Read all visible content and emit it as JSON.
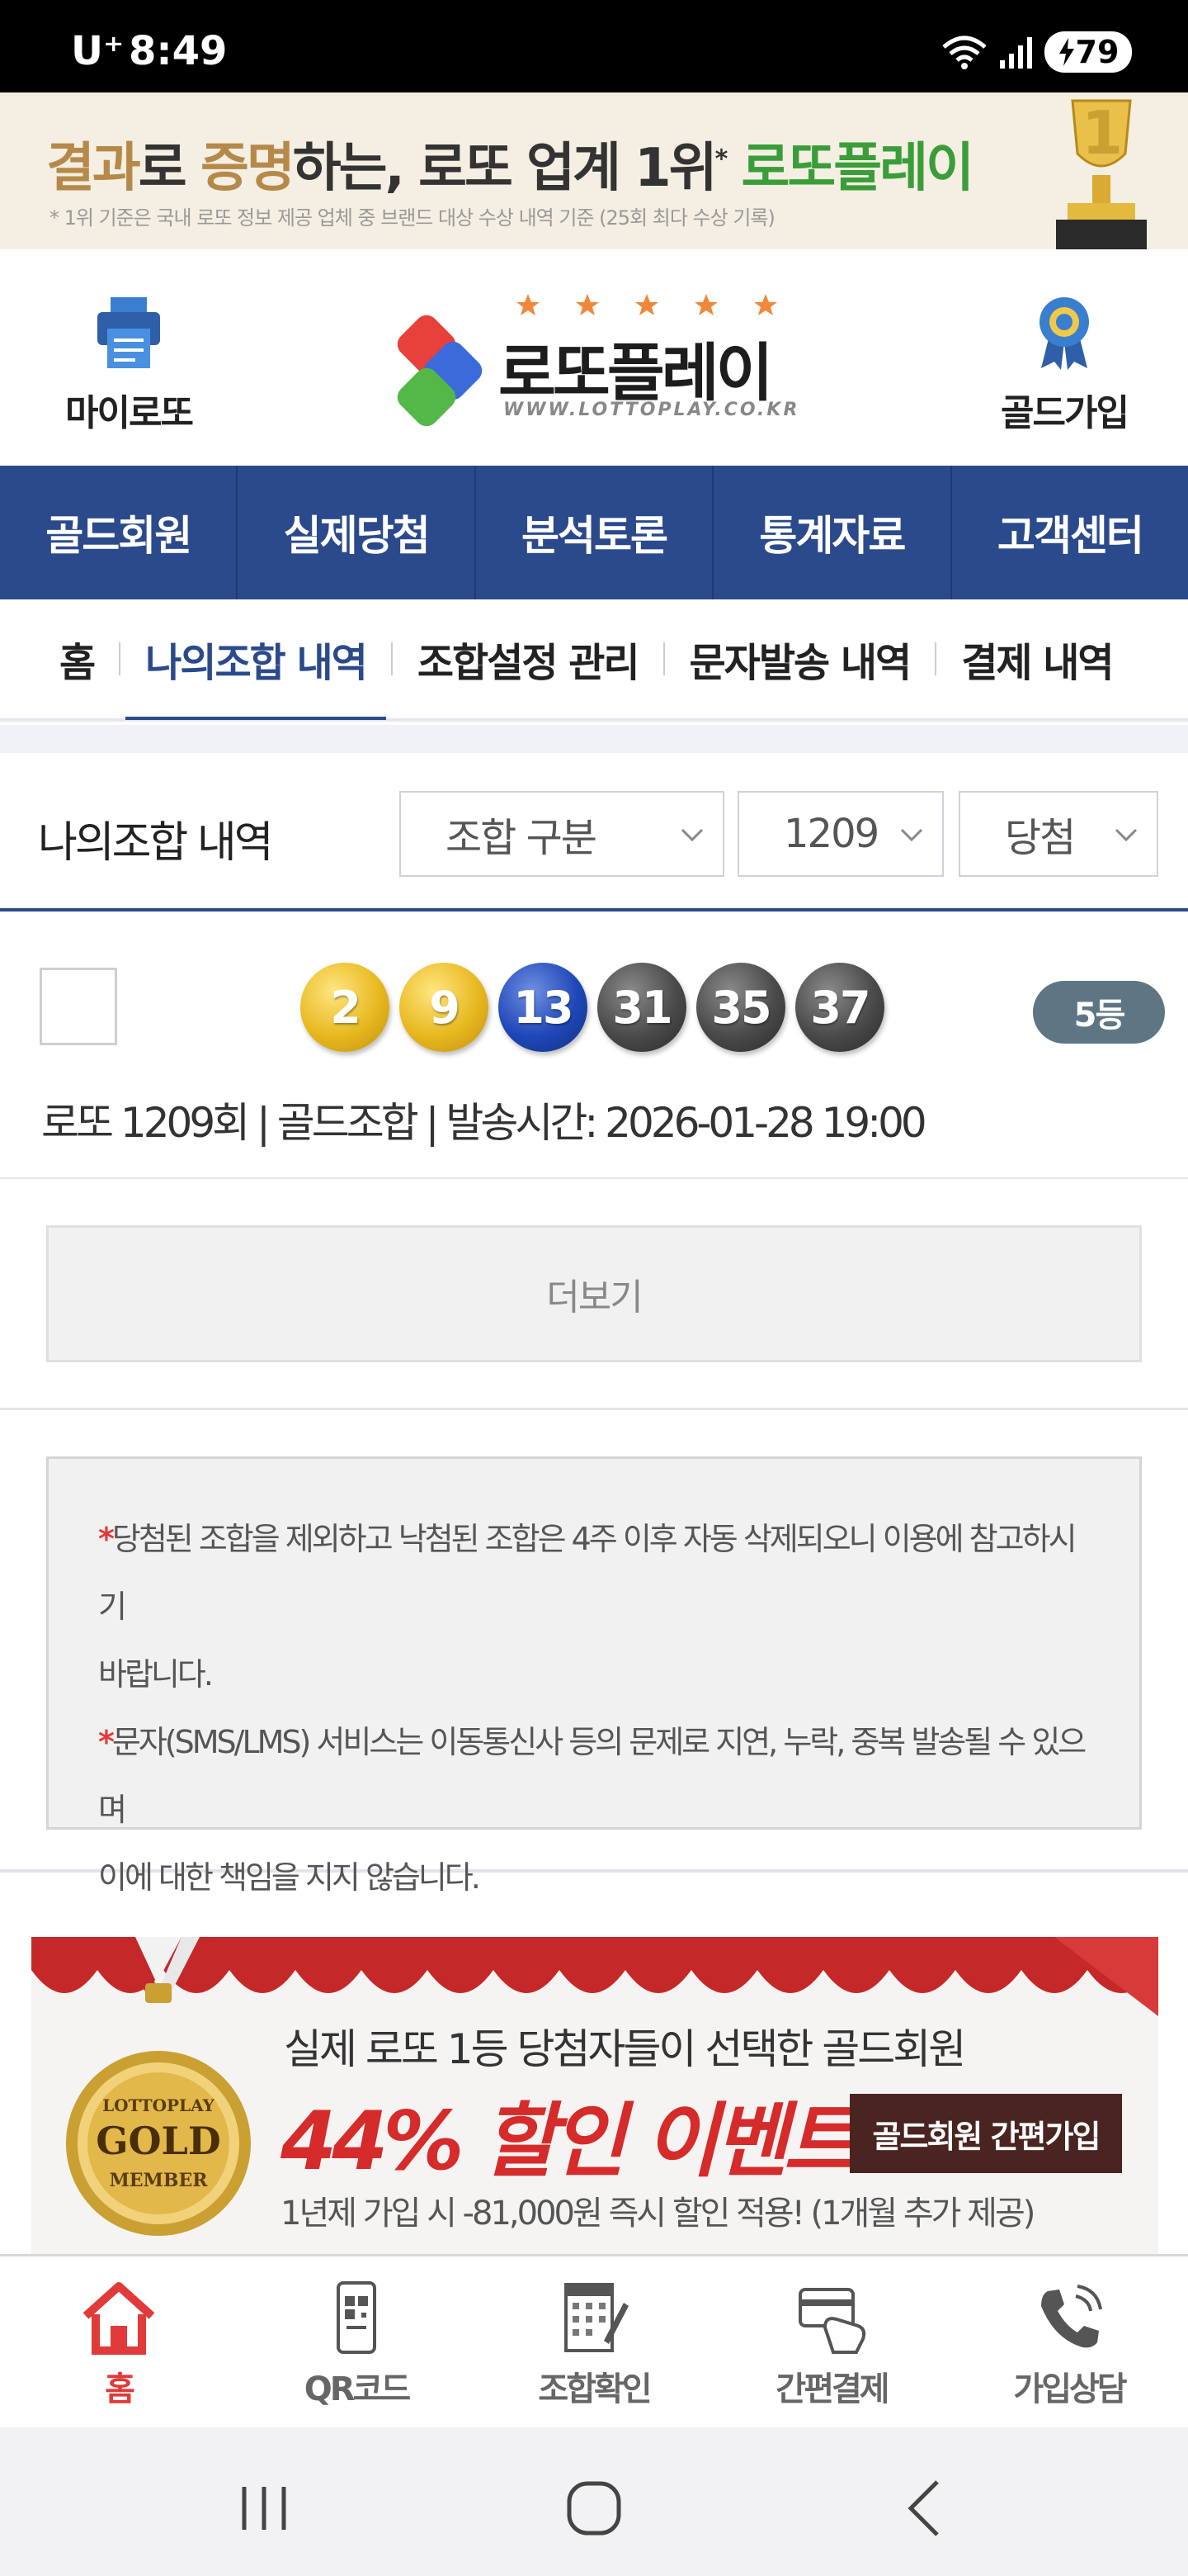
{
  "status_bar": {
    "carrier": "U⁺",
    "time": "8:49",
    "battery": "79"
  },
  "top_banner": {
    "title_part1": "결과",
    "title_part2": "로 ",
    "title_part3": "증명",
    "title_part4": "하는, ",
    "title_part5": "로또 업계 1위",
    "title_part6": "*",
    "title_part7": " 로또플레이",
    "note": "* 1위 기준은 국내 로또 정보 제공 업체 중 브랜드 대상 수상 내역 기준 (25회 최다 수상 기록)"
  },
  "header": {
    "left_label": "마이로또",
    "right_label": "골드가입",
    "logo_text": "로또플레이",
    "logo_url": "WWW.LOTTOPLAY.CO.KR"
  },
  "main_nav": [
    "골드회원",
    "실제당첨",
    "분석토론",
    "통계자료",
    "고객센터"
  ],
  "sub_tabs": [
    "홈",
    "나의조합 내역",
    "조합설정 관리",
    "문자발송 내역",
    "결제 내역"
  ],
  "filter": {
    "title": "나의조합 내역",
    "select_type": "조합 구분",
    "select_round": "1209",
    "select_result": "당첨"
  },
  "result": {
    "numbers": [
      "2",
      "9",
      "13",
      "31",
      "35",
      "37"
    ],
    "rank": "5등",
    "info": "로또 1209회 | 골드조합 | 발송시간: 2026-01-28 19:00"
  },
  "more_button": "더보기",
  "notice": {
    "star": "*",
    "line1": "당첨된 조합을 제외하고 낙첨된 조합은 4주 이후 자동 삭제되오니 이용에 참고하시기",
    "line1b": "바랍니다.",
    "line2": "문자(SMS/LMS) 서비스는 이동통신사 등의 문제로 지연, 누락, 중복 발송될 수 있으며",
    "line2b": "이에 대한 책임을 지지 않습니다."
  },
  "promo": {
    "line1": "실제 로또 1등 당첨자들이 선택한 골드회원",
    "line2": "44% 할인 이벤트!",
    "button": "골드회원 간편가입",
    "line3": "1년제 가입 시 -81,000원 즉시 할인 적용! (1개월 추가 제공)",
    "medal_top": "LOTTOPLAY",
    "medal_mid": "GOLD",
    "medal_bottom": "MEMBER"
  },
  "tab_bar": [
    "홈",
    "QR코드",
    "조합확인",
    "간편결제",
    "가입상담"
  ],
  "colors": {
    "nav_blue": "#2b4a8b",
    "accent_red": "#e03a3a",
    "badge_gray": "#5e7683",
    "ball_yellow": "#e8b820",
    "ball_blue": "#1f47b8",
    "ball_gray": "#4a4a4a"
  },
  "icons": {
    "left_header": "printer-document-icon",
    "right_header": "medal-badge-icon",
    "tabs": [
      "home-icon",
      "qr-phone-icon",
      "lotto-slip-icon",
      "card-payment-icon",
      "phone-call-icon"
    ]
  }
}
